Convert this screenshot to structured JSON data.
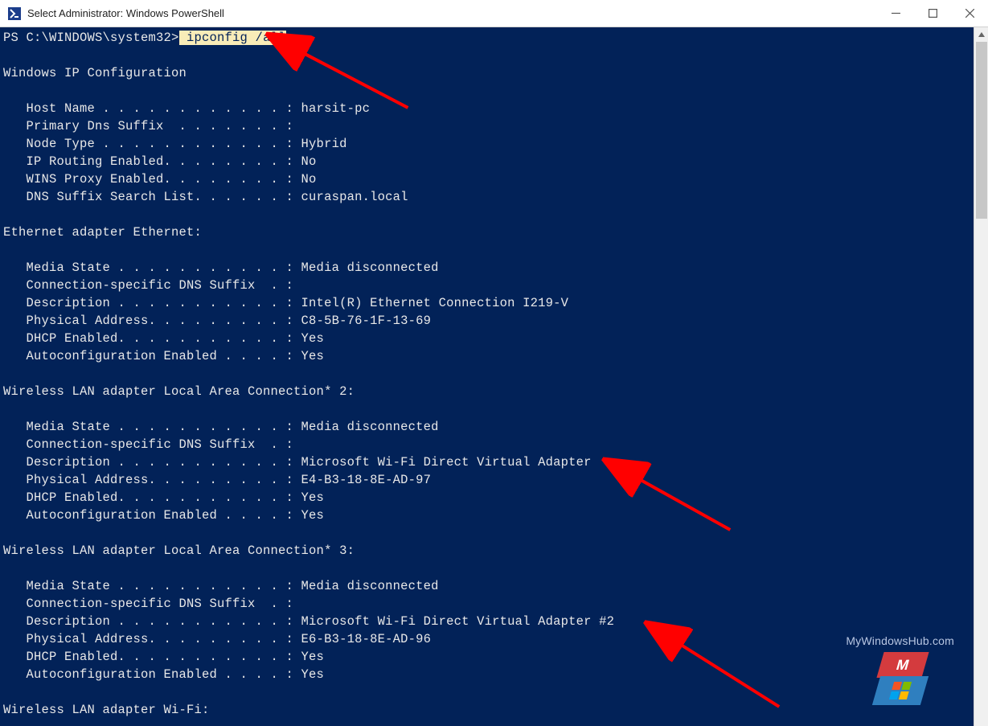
{
  "titlebar": {
    "title": "Select Administrator: Windows PowerShell"
  },
  "terminal": {
    "prompt": "PS C:\\WINDOWS\\system32>",
    "command_hl": " ipconfig /all",
    "section_head": "Windows IP Configuration",
    "config": {
      "host_name": "   Host Name . . . . . . . . . . . . : harsit-pc",
      "primary_dns": "   Primary Dns Suffix  . . . . . . . :",
      "node_type": "   Node Type . . . . . . . . . . . . : Hybrid",
      "ip_routing": "   IP Routing Enabled. . . . . . . . : No",
      "wins_proxy": "   WINS Proxy Enabled. . . . . . . . : No",
      "dns_suffix_list": "   DNS Suffix Search List. . . . . . : curaspan.local"
    },
    "eth_head": "Ethernet adapter Ethernet:",
    "eth": {
      "media_state": "   Media State . . . . . . . . . . . : Media disconnected",
      "conn_dns": "   Connection-specific DNS Suffix  . :",
      "description": "   Description . . . . . . . . . . . : Intel(R) Ethernet Connection I219-V",
      "phys_addr": "   Physical Address. . . . . . . . . : C8-5B-76-1F-13-69",
      "dhcp": "   DHCP Enabled. . . . . . . . . . . : Yes",
      "autoconf": "   Autoconfiguration Enabled . . . . : Yes"
    },
    "wlan2_head": "Wireless LAN adapter Local Area Connection* 2:",
    "wlan2": {
      "media_state": "   Media State . . . . . . . . . . . : Media disconnected",
      "conn_dns": "   Connection-specific DNS Suffix  . :",
      "description": "   Description . . . . . . . . . . . : Microsoft Wi-Fi Direct Virtual Adapter",
      "phys_addr": "   Physical Address. . . . . . . . . : E4-B3-18-8E-AD-97",
      "dhcp": "   DHCP Enabled. . . . . . . . . . . : Yes",
      "autoconf": "   Autoconfiguration Enabled . . . . : Yes"
    },
    "wlan3_head": "Wireless LAN adapter Local Area Connection* 3:",
    "wlan3": {
      "media_state": "   Media State . . . . . . . . . . . : Media disconnected",
      "conn_dns": "   Connection-specific DNS Suffix  . :",
      "description": "   Description . . . . . . . . . . . : Microsoft Wi-Fi Direct Virtual Adapter #2",
      "phys_addr": "   Physical Address. . . . . . . . . : E6-B3-18-8E-AD-96",
      "dhcp": "   DHCP Enabled. . . . . . . . . . . : Yes",
      "autoconf": "   Autoconfiguration Enabled . . . . : Yes"
    },
    "wifi_head": "Wireless LAN adapter Wi-Fi:"
  },
  "watermark": {
    "text": "MyWindowsHub.com",
    "top_letter": "M"
  }
}
